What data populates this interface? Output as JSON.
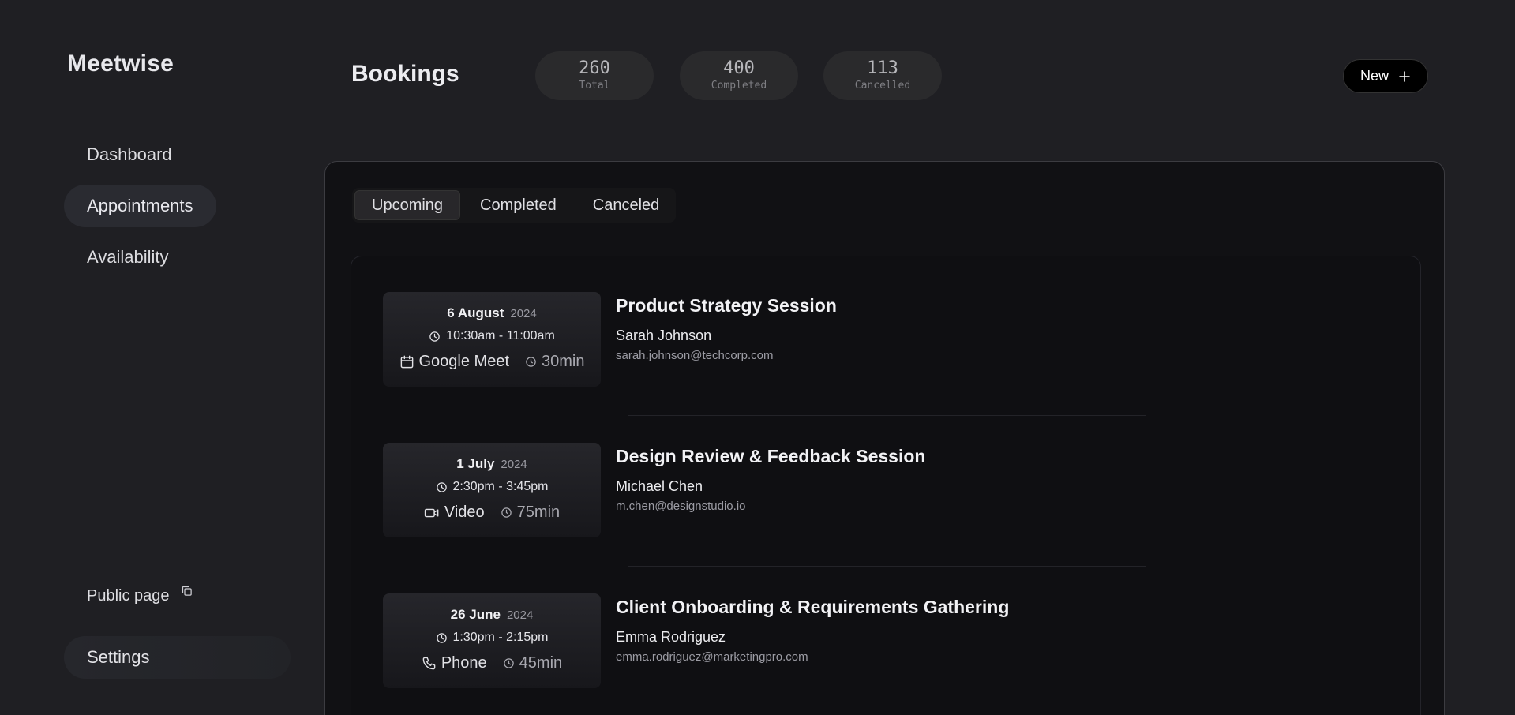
{
  "app": {
    "brand": "Meetwise"
  },
  "sidebar": {
    "items": [
      {
        "label": "Dashboard"
      },
      {
        "label": "Appointments"
      },
      {
        "label": "Availability"
      }
    ],
    "public_page": "Public page",
    "settings": "Settings"
  },
  "header": {
    "title": "Bookings",
    "stats": [
      {
        "value": "260",
        "label": "Total"
      },
      {
        "value": "400",
        "label": "Completed"
      },
      {
        "value": "113",
        "label": "Cancelled"
      }
    ],
    "new_button": "New"
  },
  "tabs": [
    {
      "label": "Upcoming",
      "active": true
    },
    {
      "label": "Completed",
      "active": false
    },
    {
      "label": "Canceled",
      "active": false
    }
  ],
  "bookings": [
    {
      "date": "6 August",
      "year": "2024",
      "time": "10:30am - 11:00am",
      "platform": "Google Meet",
      "platform_icon": "calendar-icon",
      "duration": "30min",
      "title": "Product Strategy Session",
      "name": "Sarah Johnson",
      "email": "sarah.johnson@techcorp.com"
    },
    {
      "date": "1 July",
      "year": "2024",
      "time": "2:30pm - 3:45pm",
      "platform": "Video",
      "platform_icon": "video-icon",
      "duration": "75min",
      "title": "Design Review & Feedback Session",
      "name": "Michael Chen",
      "email": "m.chen@designstudio.io"
    },
    {
      "date": "26 June",
      "year": "2024",
      "time": "1:30pm - 2:15pm",
      "platform": "Phone",
      "platform_icon": "phone-icon",
      "duration": "45min",
      "title": "Client Onboarding & Requirements Gathering",
      "name": "Emma Rodriguez",
      "email": "emma.rodriguez@marketingpro.com"
    }
  ]
}
